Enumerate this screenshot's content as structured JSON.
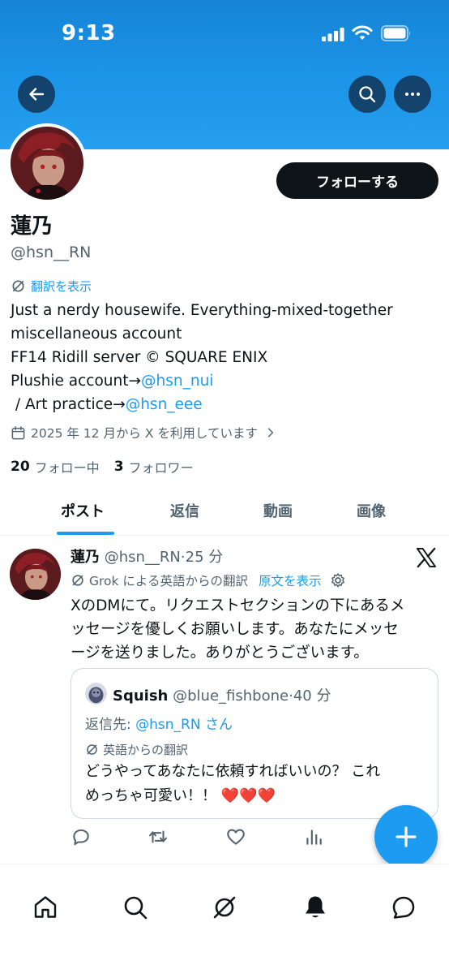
{
  "status_bar": {
    "time": "9:13"
  },
  "header": {
    "back_icon": "arrow-left-icon",
    "search_icon": "search-icon",
    "more_icon": "more-icon"
  },
  "profile": {
    "display_name": "蓮乃",
    "handle": "@hsn__RN",
    "follow_label": "フォローする",
    "translate_label": "翻訳を表示",
    "bio_lines": [
      "Just a nerdy housewife. Everything-mixed-together",
      "miscellaneous account",
      "FF14 Ridill server © SQUARE ENIX"
    ],
    "bio_plushie_prefix": "Plushie account→",
    "bio_plushie_link": "@hsn_nui",
    "bio_art_prefix": " / Art practice→",
    "bio_art_link": "@hsn_eee",
    "joined": "2025 年 12 月から X を利用しています",
    "following_count": "20",
    "following_label": "フォロー中",
    "followers_count": "3",
    "followers_label": "フォロワー"
  },
  "tabs": [
    {
      "label": "ポスト",
      "active": true
    },
    {
      "label": "返信",
      "active": false
    },
    {
      "label": "動画",
      "active": false
    },
    {
      "label": "画像",
      "active": false
    }
  ],
  "tweet": {
    "name": "蓮乃",
    "handle": "@hsn__RN",
    "separator": "·",
    "time": "25 分",
    "grok_label": "Grok による英語からの翻訳",
    "show_original": "原文を表示",
    "text_lines": [
      "XのDMにて。リクエストセクションの下にあるメ",
      "ッセージを優しくお願いします。あなたにメッセ",
      "ージを送りました。ありがとうございます。"
    ],
    "quote": {
      "name": "Squish",
      "handle": "@blue_fishbone",
      "separator": "·",
      "time": "40 分",
      "reply_prefix": "返信先: ",
      "reply_target": "@hsn_RN さん",
      "translation_label": "英語からの翻訳",
      "text_lines": [
        "どうやってあなたに依頼すればいいの？ これ",
        "めっちゃ可愛い！！ ❤️❤️❤️"
      ]
    }
  },
  "colors": {
    "accent": "#1d9bf0",
    "banner": "#1d95e8",
    "text": "#0f1419",
    "muted": "#536471"
  },
  "bottom_nav": [
    "home-icon",
    "search-icon",
    "grok-icon",
    "notifications-icon",
    "messages-icon"
  ]
}
